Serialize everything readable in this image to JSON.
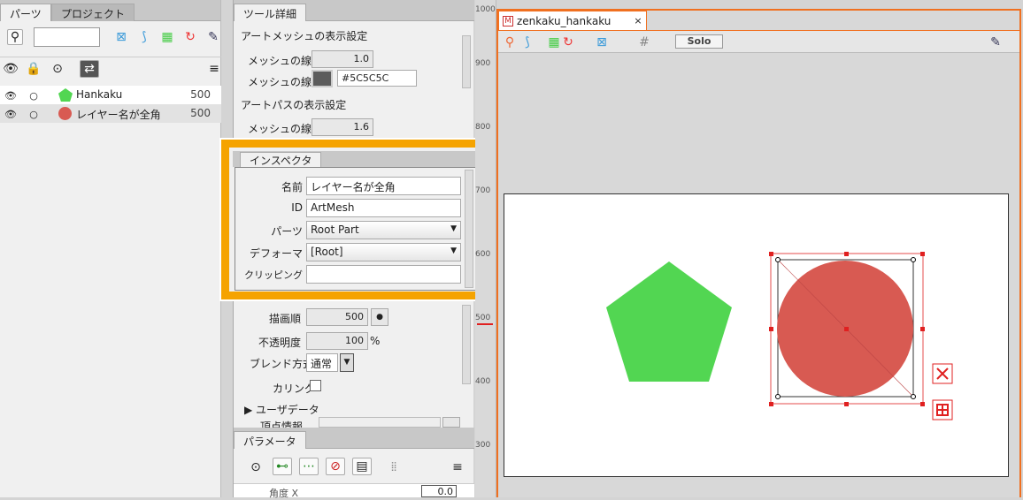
{
  "left_panel": {
    "tabs": [
      "パーツ",
      "プロジェクト"
    ],
    "layers": [
      {
        "name": "Hankaku",
        "value": "500"
      },
      {
        "name": "レイヤー名が全角",
        "value": "500"
      }
    ]
  },
  "tool_detail": {
    "tab": "ツール詳細",
    "artmesh_section": "アートメッシュの表示設定",
    "mesh_width_label": "メッシュの線幅",
    "mesh_width_value": "1.0",
    "mesh_color_label": "メッシュの線色",
    "mesh_color_value": "#5C5C5C",
    "artpath_section": "アートパスの表示設定",
    "path_width_label": "メッシュの線幅",
    "path_width_value": "1.6"
  },
  "inspector": {
    "tab": "インスペクタ",
    "name_label": "名前",
    "name_value": "レイヤー名が全角",
    "id_label": "ID",
    "id_value": "ArtMesh",
    "parts_label": "パーツ",
    "parts_value": "Root Part",
    "deformer_label": "デフォーマ",
    "deformer_value": "[Root]",
    "clipping_label": "クリッピング",
    "clipping_value": "",
    "draw_order_label": "描画順",
    "draw_order_value": "500",
    "opacity_label": "不透明度",
    "opacity_value": "100",
    "opacity_unit": "%",
    "blend_label": "ブレンド方式",
    "blend_value": "通常",
    "culling_label": "カリング",
    "userdata_label": "▶ ユーザデータ",
    "vertex_label": "頂点情報"
  },
  "parameters": {
    "tab": "パラメータ",
    "row_label": "角度 X",
    "row_value": "0.0"
  },
  "canvas": {
    "tab_title": "zenkaku_hankaku",
    "solo_label": "Solo",
    "ruler_labels": [
      "1000",
      "900",
      "800",
      "700",
      "600",
      "500",
      "400",
      "300"
    ],
    "shape_colors": {
      "pentagon": "#52d652",
      "circle": "#d85a52",
      "selection": "#e02020"
    }
  }
}
